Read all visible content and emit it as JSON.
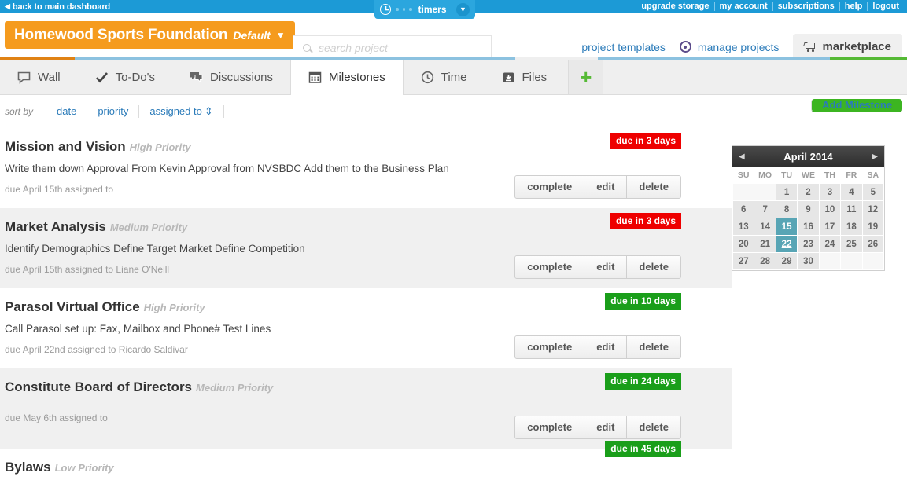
{
  "topbar": {
    "back_label": "back to main dashboard",
    "back_icon": "chevron-left-icon",
    "links": [
      "upgrade storage",
      "my account",
      "subscriptions",
      "help",
      "logout"
    ],
    "timers": {
      "label": "timers",
      "clock_icon": "clock-icon",
      "caret_icon": "chevron-down-icon"
    }
  },
  "header": {
    "project_name": "Homewood Sports Foundation",
    "project_variant": "Default",
    "project_caret": "chevron-down-icon",
    "search": {
      "value": "",
      "placeholder": "search project",
      "icon": "search-icon"
    },
    "project_templates": "project templates",
    "manage_projects": "manage projects",
    "manage_projects_icon": "gear-icon",
    "marketplace": "marketplace",
    "marketplace_icon": "cart-icon"
  },
  "tabs": [
    {
      "label": "Wall",
      "icon": "speech-bubble-icon",
      "active": false
    },
    {
      "label": "To-Do's",
      "icon": "check-icon",
      "active": false
    },
    {
      "label": "Discussions",
      "icon": "chat-icon",
      "active": false
    },
    {
      "label": "Milestones",
      "icon": "calendar-icon",
      "active": true
    },
    {
      "label": "Time",
      "icon": "clock-icon",
      "active": false
    },
    {
      "label": "Files",
      "icon": "save-disk-icon",
      "active": false
    }
  ],
  "add_tab_label": "+",
  "sortbar": {
    "label": "sort by",
    "options": [
      "date",
      "priority",
      "assigned to"
    ],
    "assigned_to_caret": "updown-arrow-icon",
    "add_milestone": "Add Milestone"
  },
  "milestones": [
    {
      "title": "Mission and Vision",
      "priority": "High Priority",
      "description": "Write them down Approval From Kevin Approval from NVSBDC Add them to the Business Plan",
      "meta": "due April 15th assigned to",
      "due_badge": "due in 3 days",
      "due_state": "red",
      "buttons": [
        "complete",
        "edit",
        "delete"
      ]
    },
    {
      "title": "Market Analysis",
      "priority": "Medium Priority",
      "description": "Identify Demographics Define Target Market Define Competition",
      "meta": "due April 15th assigned to Liane O'Neill",
      "due_badge": "due in 3 days",
      "due_state": "red",
      "buttons": [
        "complete",
        "edit",
        "delete"
      ]
    },
    {
      "title": "Parasol Virtual Office",
      "priority": "High Priority",
      "description": "Call Parasol set up: Fax, Mailbox and Phone# Test Lines",
      "meta": "due April 22nd assigned to Ricardo Saldivar",
      "due_badge": "due in 10 days",
      "due_state": "green",
      "buttons": [
        "complete",
        "edit",
        "delete"
      ]
    },
    {
      "title": "Constitute Board of Directors",
      "priority": "Medium Priority",
      "description": "",
      "meta": "due May 6th assigned to",
      "due_badge": "due in 24 days",
      "due_state": "green",
      "buttons": [
        "complete",
        "edit",
        "delete"
      ]
    },
    {
      "title": "Bylaws",
      "priority": "Low Priority",
      "description": "",
      "meta": "",
      "due_badge": "due in 45 days",
      "due_state": "green",
      "buttons": []
    }
  ],
  "calendar": {
    "title": "April 2014",
    "prev_icon": "triangle-left-icon",
    "next_icon": "triangle-right-icon",
    "weekdays": [
      "SU",
      "MO",
      "TU",
      "WE",
      "TH",
      "FR",
      "SA"
    ],
    "weeks": [
      [
        "",
        "",
        "1",
        "2",
        "3",
        "4",
        "5"
      ],
      [
        "6",
        "7",
        "8",
        "9",
        "10",
        "11",
        "12"
      ],
      [
        "13",
        "14",
        "15",
        "16",
        "17",
        "18",
        "19"
      ],
      [
        "20",
        "21",
        "22",
        "23",
        "24",
        "25",
        "26"
      ],
      [
        "27",
        "28",
        "29",
        "30",
        "",
        "",
        ""
      ]
    ],
    "highlighted": [
      "15",
      "22"
    ],
    "linked": [
      "22"
    ]
  },
  "colors": {
    "topbar_blue": "#1c9ad6",
    "project_orange": "#f59b1e",
    "add_green": "#3cb521",
    "badge_red": "#ee0000",
    "badge_green": "#1a9e1a",
    "calendar_highlight": "#58a5b5",
    "link_blue": "#2b7bb9"
  }
}
